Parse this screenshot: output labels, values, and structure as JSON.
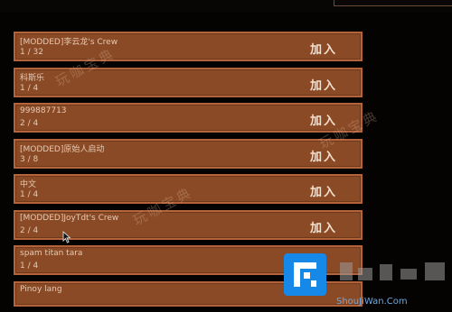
{
  "header": {
    "title": ""
  },
  "servers": [
    {
      "name": "[MODDED]李云龙's Crew",
      "players": "1 / 32",
      "join_label": "加入"
    },
    {
      "name": "科斯乐",
      "players": "1 / 4",
      "join_label": "加入"
    },
    {
      "name": "999887713",
      "players": "2 / 4",
      "join_label": "加入"
    },
    {
      "name": "[MODDED]原始人启动",
      "players": "3 / 8",
      "join_label": "加入"
    },
    {
      "name": "中文",
      "players": "1 / 4",
      "join_label": "加入"
    },
    {
      "name": "[MODDED]JoyTdt's Crew",
      "players": "2 / 4",
      "join_label": "加入"
    },
    {
      "name": "spam titan tara",
      "players": "1 / 4",
      "join_label": ""
    },
    {
      "name": "Pinoy lang",
      "players": "",
      "join_label": ""
    }
  ],
  "watermark": {
    "text": "玩咖宝典"
  },
  "logo": {
    "text": "ShouJiWan.Com"
  },
  "colors": {
    "row_fill": "#8a4a26",
    "row_border": "#b5633a",
    "text": "#e7c9b2",
    "background": "#050302"
  }
}
